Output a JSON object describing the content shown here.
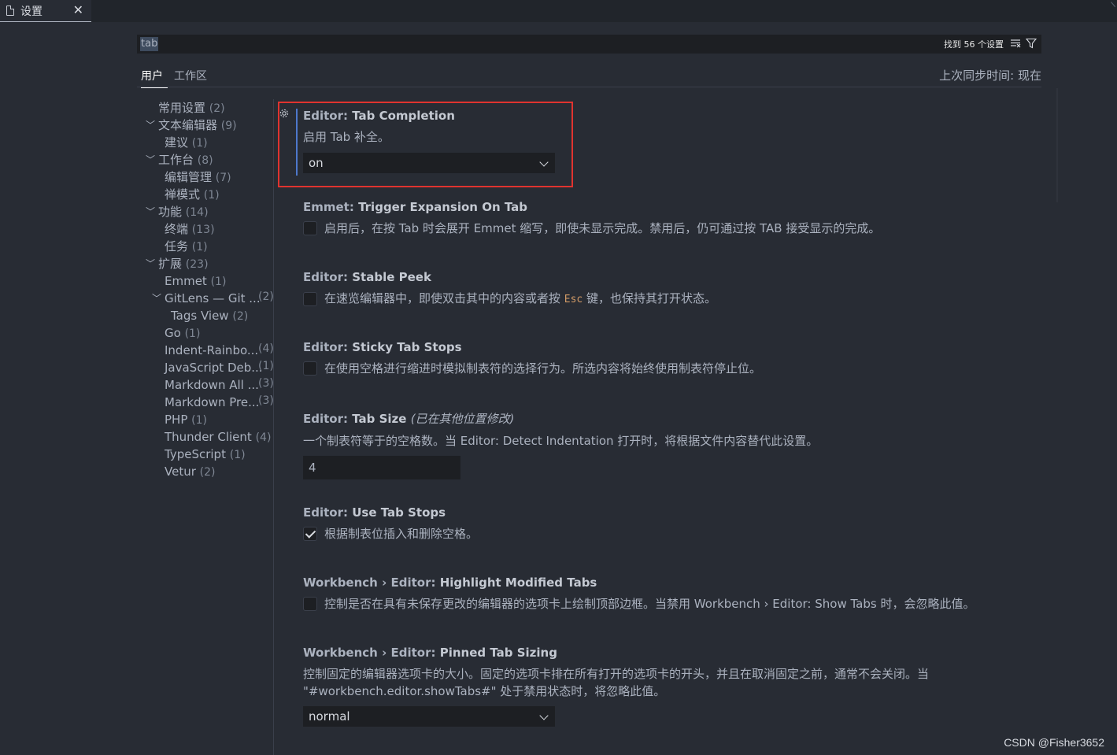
{
  "tab": {
    "label": "设置",
    "close": "✕"
  },
  "search": {
    "query": "tab",
    "result_count": "找到 56 个设置"
  },
  "scopes": {
    "user": "用户",
    "workspace": "工作区",
    "sync_status": "上次同步时间: 现在"
  },
  "toc": [
    {
      "label": "常用设置",
      "count": "(2)"
    },
    {
      "label": "文本编辑器",
      "count": "(9)"
    },
    {
      "label": "建议",
      "count": "(1)"
    },
    {
      "label": "工作台",
      "count": "(8)"
    },
    {
      "label": "编辑管理",
      "count": "(7)"
    },
    {
      "label": "禅模式",
      "count": "(1)"
    },
    {
      "label": "功能",
      "count": "(14)"
    },
    {
      "label": "终端",
      "count": "(13)"
    },
    {
      "label": "任务",
      "count": "(1)"
    },
    {
      "label": "扩展",
      "count": "(23)"
    },
    {
      "label": "Emmet",
      "count": "(1)"
    },
    {
      "label": "GitLens — Git ...",
      "count": "(2)"
    },
    {
      "label": "Tags View",
      "count": "(2)"
    },
    {
      "label": "Go",
      "count": "(1)"
    },
    {
      "label": "Indent-Rainbo...",
      "count": "(4)"
    },
    {
      "label": "JavaScript Deb...",
      "count": "(1)"
    },
    {
      "label": "Markdown All ...",
      "count": "(3)"
    },
    {
      "label": "Markdown Pre...",
      "count": "(3)"
    },
    {
      "label": "PHP",
      "count": "(1)"
    },
    {
      "label": "Thunder Client",
      "count": "(4)"
    },
    {
      "label": "TypeScript",
      "count": "(1)"
    },
    {
      "label": "Vetur",
      "count": "(2)"
    }
  ],
  "settings": {
    "tab_completion": {
      "category": "Editor: ",
      "name": "Tab Completion",
      "desc": "启用 Tab 补全。",
      "value": "on"
    },
    "emmet_trigger": {
      "category": "Emmet: ",
      "name": "Trigger Expansion On Tab",
      "desc": "启用后，在按 Tab 时会展开 Emmet 缩写，即使未显示完成。禁用后，仍可通过按 TAB 接受显示的完成。",
      "checked": false
    },
    "stable_peek": {
      "category": "Editor: ",
      "name": "Stable Peek",
      "desc_pre": "在速览编辑器中，即使双击其中的内容或者按 ",
      "desc_code": "Esc",
      "desc_post": " 键，也保持其打开状态。",
      "checked": false
    },
    "sticky_tab_stops": {
      "category": "Editor: ",
      "name": "Sticky Tab Stops",
      "desc": "在使用空格进行缩进时模拟制表符的选择行为。所选内容将始终使用制表符停止位。",
      "checked": false
    },
    "tab_size": {
      "category": "Editor: ",
      "name": "Tab Size",
      "modified": "(已在其他位置修改)",
      "desc": "一个制表符等于的空格数。当 Editor: Detect Indentation 打开时，将根据文件内容替代此设置。",
      "value": "4"
    },
    "use_tab_stops": {
      "category": "Editor: ",
      "name": "Use Tab Stops",
      "desc": "根据制表位插入和删除空格。",
      "checked": true
    },
    "highlight_modified_tabs": {
      "category": "Workbench › Editor: ",
      "name": "Highlight Modified Tabs",
      "desc": "控制是否在具有未保存更改的编辑器的选项卡上绘制顶部边框。当禁用 Workbench › Editor: Show Tabs 时，会忽略此值。",
      "checked": false
    },
    "pinned_tab_sizing": {
      "category": "Workbench › Editor: ",
      "name": "Pinned Tab Sizing",
      "desc_line1": "控制固定的编辑器选项卡的大小。固定的选项卡排在所有打开的选项卡的开头，并且在取消固定之前，通常不会关闭。当",
      "desc_line2": "\"#workbench.editor.showTabs#\" 处于禁用状态时，将忽略此值。",
      "value": "normal"
    }
  },
  "watermark": "CSDN @Fisher3652",
  "colors": {
    "background": "#282c34",
    "highlight_border": "#e0332f",
    "focus_bar": "#4d78cc"
  }
}
